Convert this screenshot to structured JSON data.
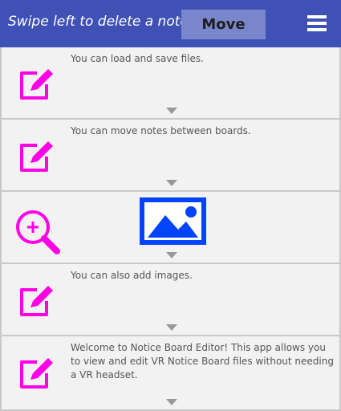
{
  "header": {
    "hint_text": "Swipe left to delete a note",
    "move_label": "Move",
    "menu_icon": "hamburger-menu-icon"
  },
  "colors": {
    "header_bg": "#3f51b5",
    "move_button_bg": "#7986cb",
    "accent_magenta": "#ff00e6",
    "image_blue": "#0044ff",
    "row_bg": "#f2f2f2"
  },
  "notes": [
    {
      "icon": "edit-note-icon",
      "text": "You can load and save files."
    },
    {
      "icon": "edit-note-icon",
      "text": "You can move notes between boards."
    },
    {
      "icon": "zoom-in-icon",
      "image": "image-placeholder-icon",
      "text": ""
    },
    {
      "icon": "edit-note-icon",
      "text": "You can also add images."
    },
    {
      "icon": "edit-note-icon",
      "text": "Welcome to Notice Board Editor!  This app allows you to view and edit VR Notice Board files without needing a VR headset."
    }
  ]
}
